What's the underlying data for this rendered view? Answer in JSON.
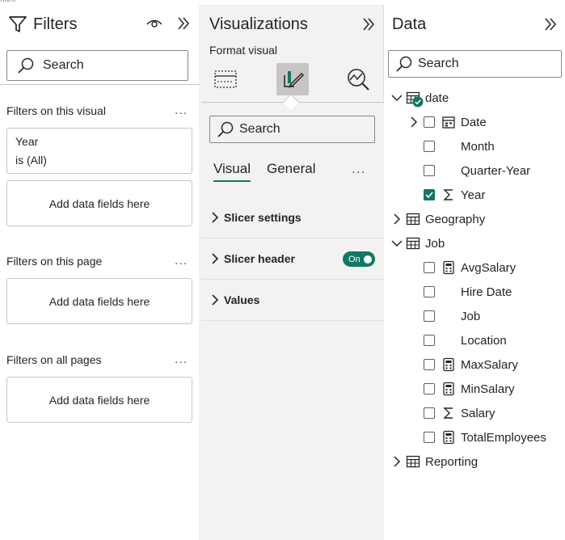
{
  "top_crop_text": "nare",
  "filters": {
    "title": "Filters",
    "search_placeholder": "Search",
    "sections": [
      {
        "title": "Filters on this visual",
        "more": "...",
        "card": {
          "field": "Year",
          "state": "is (All)"
        },
        "dropzone": "Add data fields here"
      },
      {
        "title": "Filters on this page",
        "more": "...",
        "dropzone": "Add data fields here"
      },
      {
        "title": "Filters on all pages",
        "more": "...",
        "dropzone": "Add data fields here"
      }
    ]
  },
  "visualizations": {
    "title": "Visualizations",
    "subtitle": "Format visual",
    "search_placeholder": "Search",
    "tabs": [
      "Visual",
      "General"
    ],
    "tabs_more": "...",
    "sections": [
      "Slicer settings",
      "Slicer header",
      "Values"
    ],
    "toggle_label": "On",
    "accent": "#117865"
  },
  "data": {
    "title": "Data",
    "search_placeholder": "Search",
    "tree": [
      {
        "label": "date",
        "icon": "table-icon",
        "expanded": true,
        "status": "checked"
      },
      {
        "label": "Date",
        "icon": "calendar-hierarchy-icon",
        "checked": false,
        "collapsed_child": true
      },
      {
        "label": "Month",
        "icon": "",
        "checked": false
      },
      {
        "label": "Quarter-Year",
        "icon": "",
        "checked": false
      },
      {
        "label": "Year",
        "icon": "sigma-icon",
        "checked": true
      },
      {
        "label": "Geography",
        "icon": "table-icon",
        "expanded": false
      },
      {
        "label": "Job",
        "icon": "table-icon",
        "expanded": true
      },
      {
        "label": "AvgSalary",
        "icon": "calculator-icon",
        "checked": false
      },
      {
        "label": "Hire Date",
        "icon": "",
        "checked": false
      },
      {
        "label": "Job",
        "icon": "",
        "checked": false
      },
      {
        "label": "Location",
        "icon": "",
        "checked": false
      },
      {
        "label": "MaxSalary",
        "icon": "calculator-icon",
        "checked": false
      },
      {
        "label": "MinSalary",
        "icon": "calculator-icon",
        "checked": false
      },
      {
        "label": "Salary",
        "icon": "sigma-icon",
        "checked": false
      },
      {
        "label": "TotalEmployees",
        "icon": "calculator-icon",
        "checked": false
      },
      {
        "label": "Reporting",
        "icon": "table-icon",
        "expanded": false
      }
    ]
  }
}
